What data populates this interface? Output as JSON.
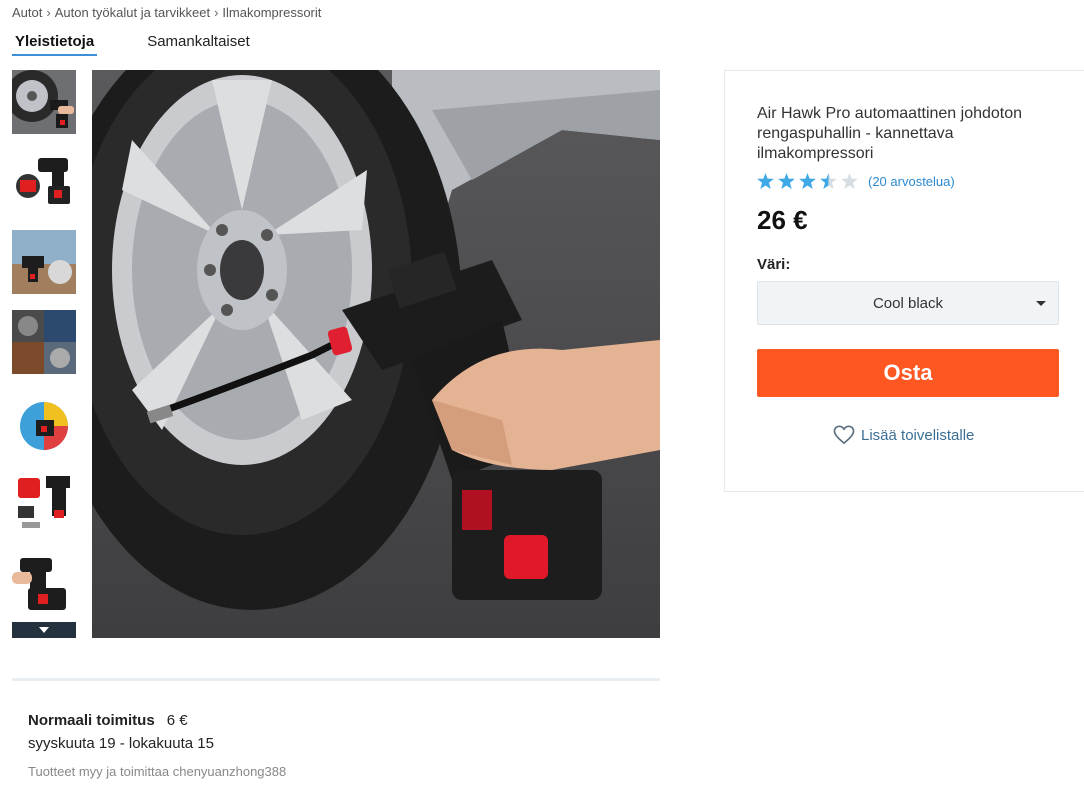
{
  "breadcrumb": [
    "Autot",
    "Auton työkalut ja tarvikkeet",
    "Ilmakompressorit"
  ],
  "tabs": [
    {
      "label": "Yleistietoja",
      "active": true
    },
    {
      "label": "Samankaltaiset",
      "active": false
    }
  ],
  "product": {
    "title": "Air Hawk Pro automaattinen johdoton rengaspuhallin - kannettava ilmakompressori",
    "rating": 3.5,
    "rating_max": 5,
    "review_count": "(20 arvostelua)",
    "price": "26 €",
    "color_label": "Väri:",
    "selected_color": "Cool black",
    "buy_label": "Osta",
    "wishlist_label": "Lisää toivelistalle"
  },
  "shipping": {
    "title": "Normaali toimitus",
    "price": "6 €",
    "dates": "syyskuuta 19 - lokakuuta 15",
    "seller": "Tuotteet myy ja toimittaa chenyuanzhong388"
  },
  "colors": {
    "accent": "#3a8fd6",
    "buy": "#ff5722",
    "star": "#3fa9e6",
    "star_empty": "#d6dde3"
  }
}
